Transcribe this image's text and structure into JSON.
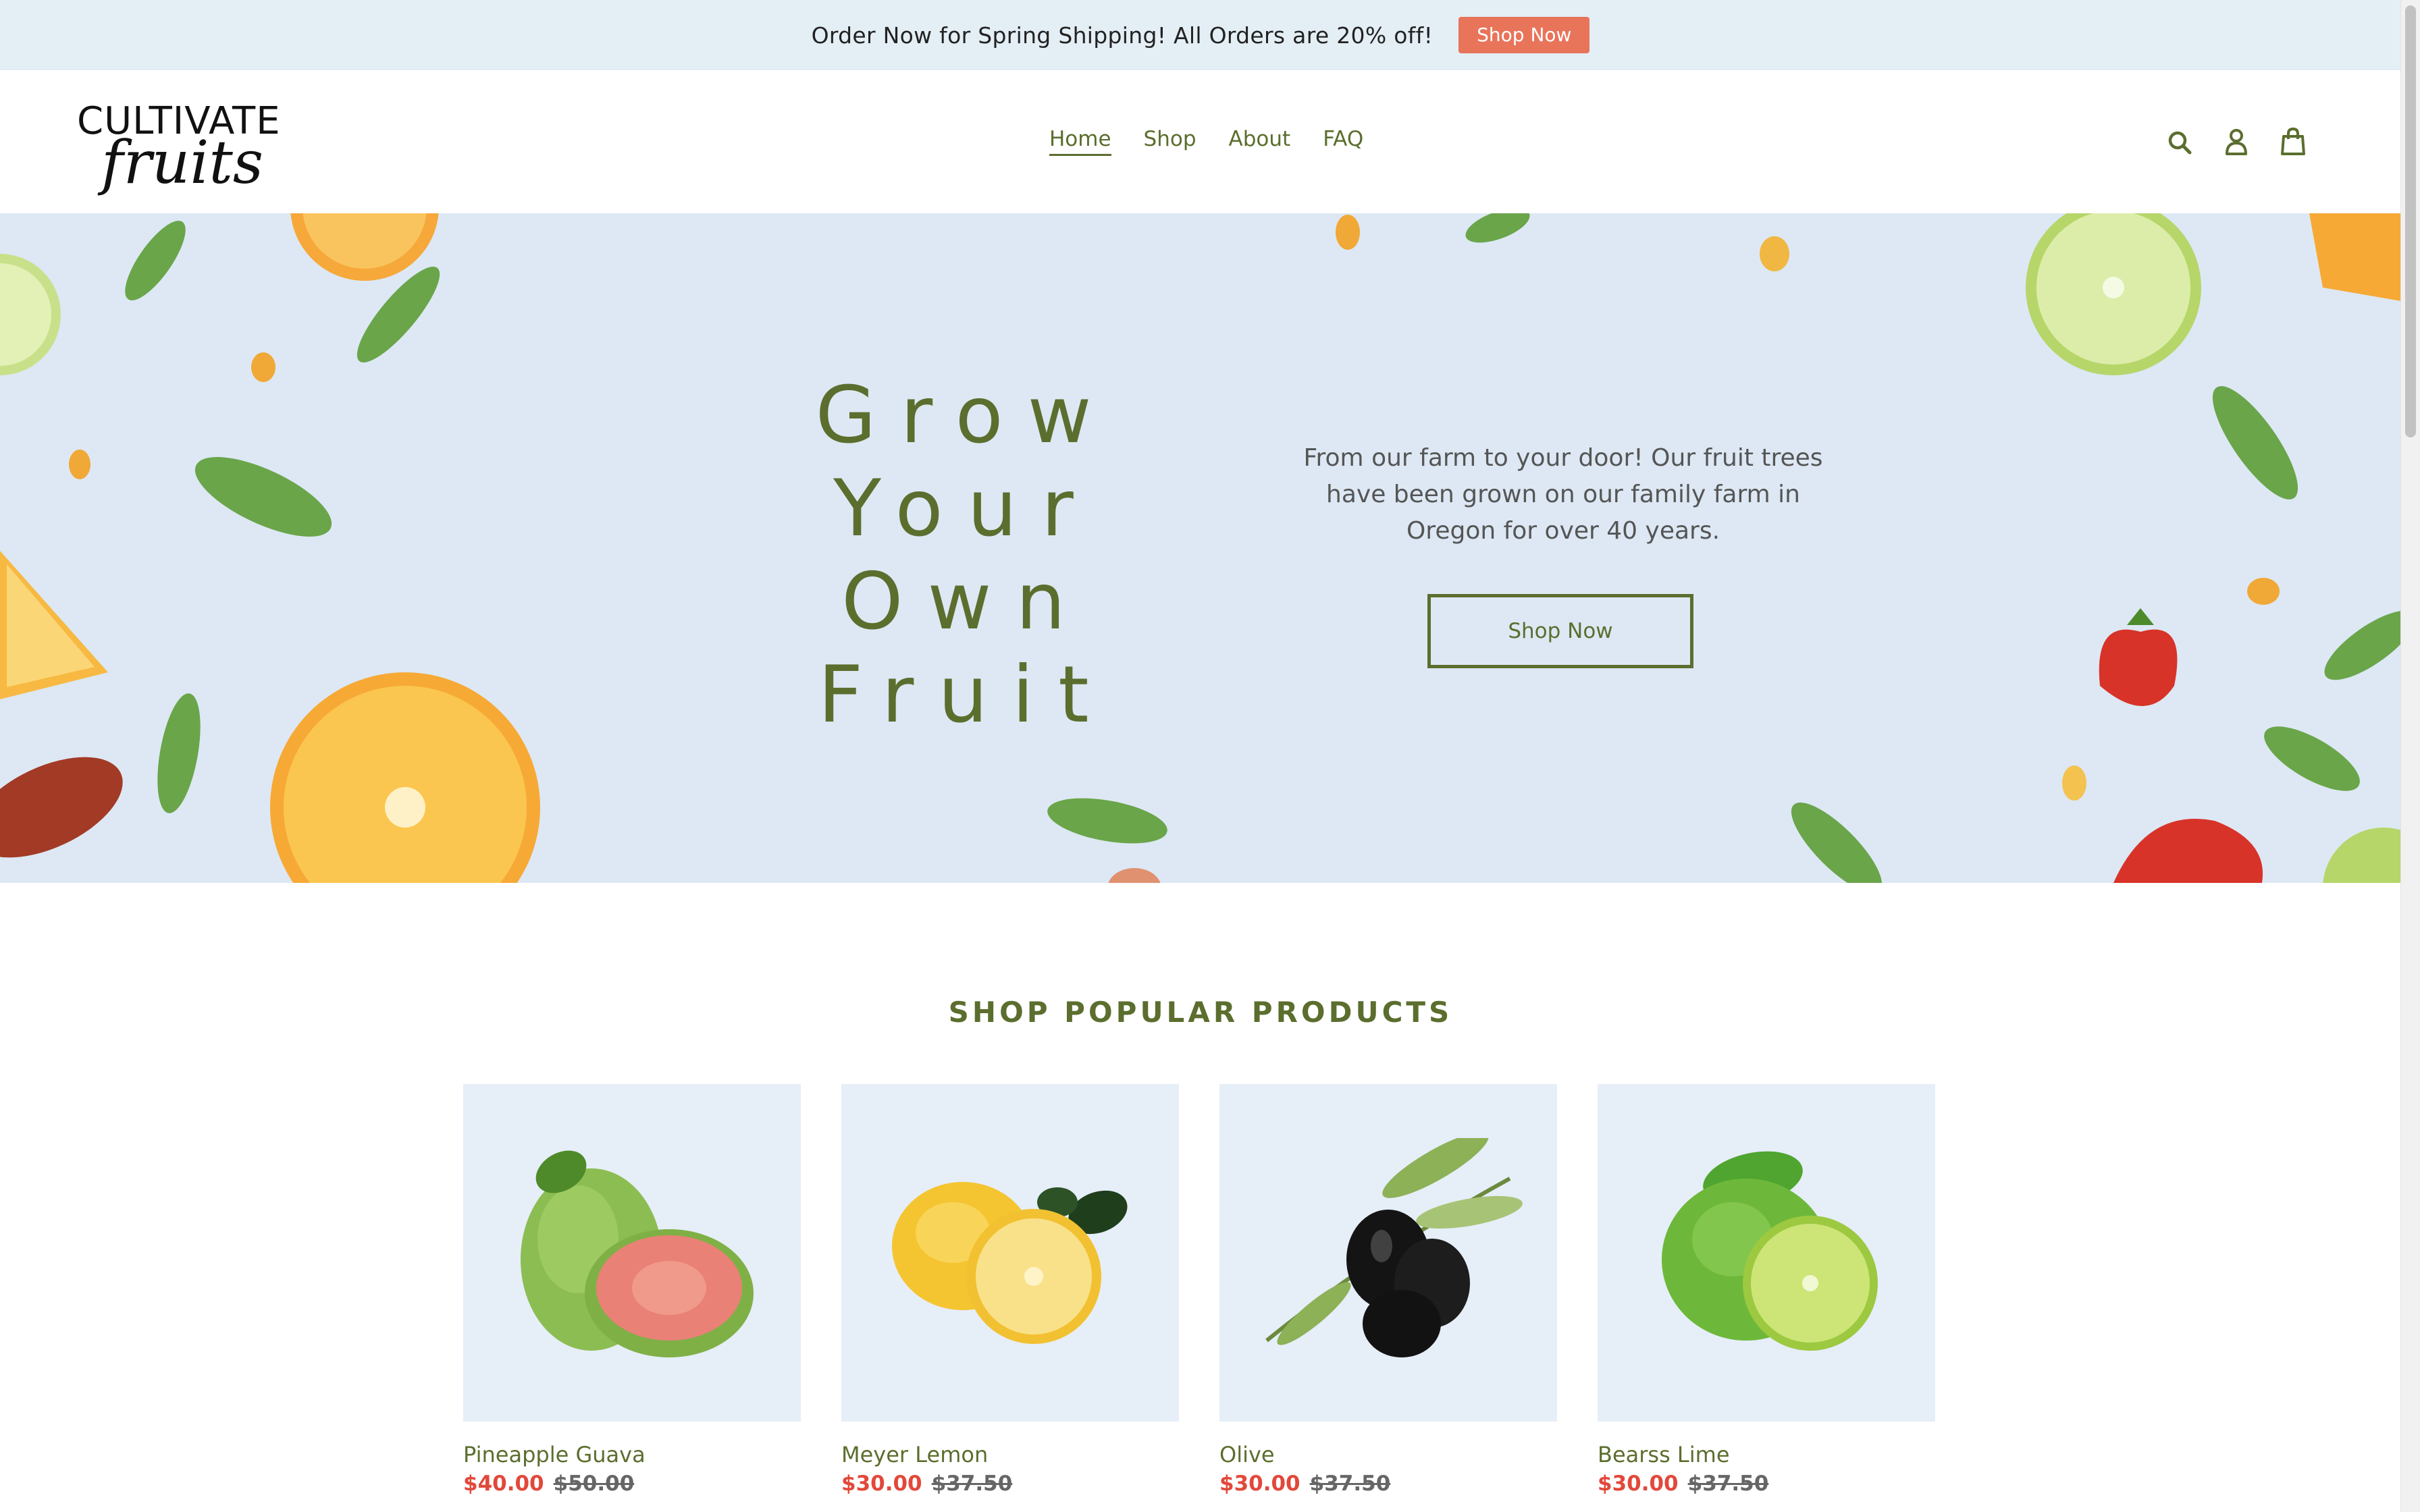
{
  "announcement": {
    "text": "Order Now for Spring Shipping! All Orders are 20% off!",
    "button_label": "Shop Now"
  },
  "logo": {
    "line1": "ULTIVATE",
    "line2": "fruits",
    "initial": "C"
  },
  "nav": {
    "items": [
      "Home",
      "Shop",
      "About",
      "FAQ"
    ],
    "active": "Home"
  },
  "header_icons": [
    "search-icon",
    "account-icon",
    "cart-icon"
  ],
  "hero": {
    "title_lines": [
      "Grow",
      "Your",
      "Own",
      "Fruit"
    ],
    "description": "From our farm to your door! Our fruit trees have been grown on our family farm in Oregon for over 40 years.",
    "button_label": "Shop Now"
  },
  "popular": {
    "title": "SHOP POPULAR PRODUCTS",
    "products": [
      {
        "name": "Pineapple Guava",
        "price": "$40.00",
        "compare_price": "$50.00"
      },
      {
        "name": "Meyer Lemon",
        "price": "$30.00",
        "compare_price": "$37.50"
      },
      {
        "name": "Olive",
        "price": "$30.00",
        "compare_price": "$37.50"
      },
      {
        "name": "Bearss Lime",
        "price": "$30.00",
        "compare_price": "$37.50"
      }
    ]
  },
  "colors": {
    "accent_green": "#5b6e2e",
    "announce_bg": "#e4eef5",
    "announce_button": "#e8745a",
    "hero_bg": "#dde8f4",
    "sale_red": "#e2483a"
  }
}
